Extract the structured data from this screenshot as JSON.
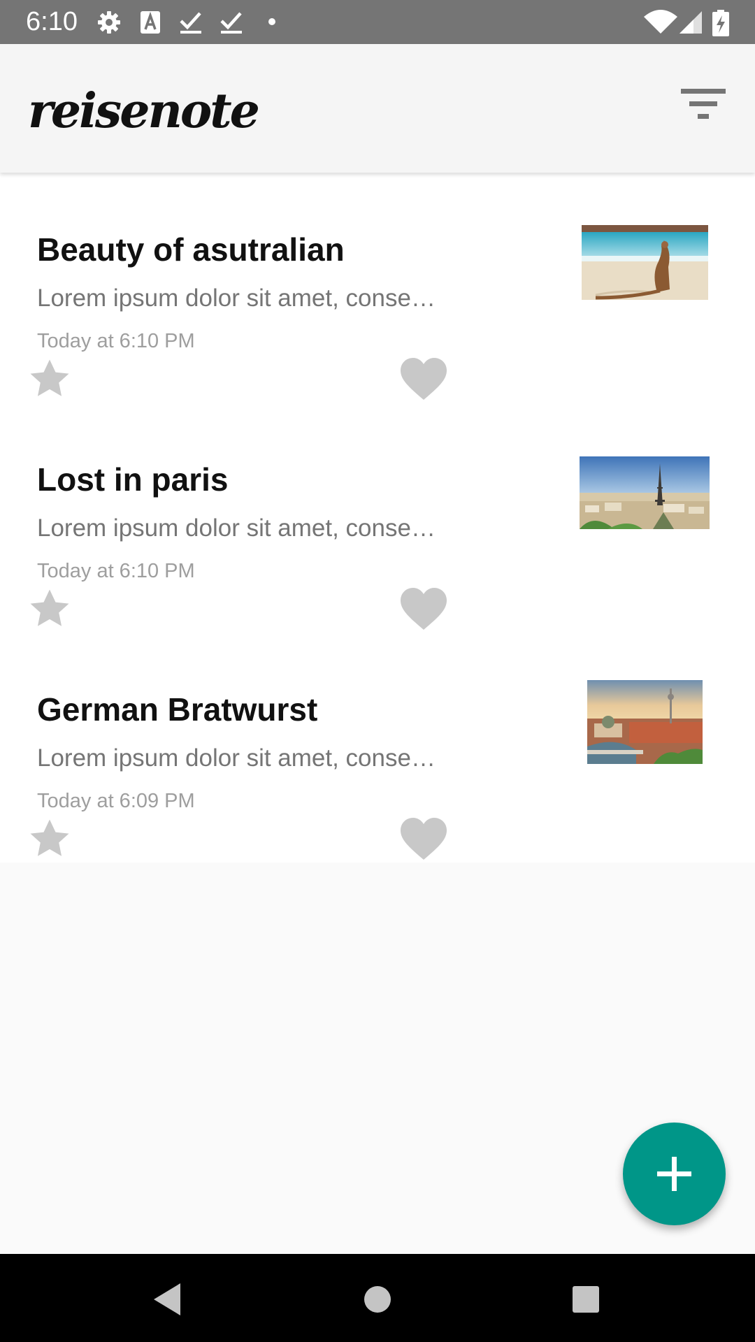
{
  "status_bar": {
    "time": "6:10",
    "icons": [
      "gear-icon",
      "a-keyboard-icon",
      "check-icon",
      "check-icon",
      "dot-icon",
      "wifi-icon",
      "signal-icon",
      "battery-charging-icon"
    ]
  },
  "app_bar": {
    "logo": "reisenote",
    "filter_icon": "filter-icon"
  },
  "notes": [
    {
      "title": "Beauty of asutralian",
      "body": "Lorem ipsum dolor sit amet, conse…",
      "date": "Today at 6:10 PM",
      "thumbnail": "kangaroo-beach-photo"
    },
    {
      "title": "Lost in paris",
      "body": "Lorem ipsum dolor sit amet, conse…",
      "date": "Today at 6:10 PM",
      "thumbnail": "paris-eiffel-photo"
    },
    {
      "title": "German Bratwurst",
      "body": "Lorem ipsum dolor sit amet, conse…",
      "date": "Today at 6:09 PM",
      "thumbnail": "berlin-city-photo"
    }
  ],
  "fab": {
    "icon": "plus-icon"
  },
  "nav_bar": {
    "icons": [
      "back-icon",
      "home-icon",
      "recents-icon"
    ]
  },
  "colors": {
    "status_bar": "#757575",
    "app_bar": "#f5f5f5",
    "accent": "#009688",
    "icon_gray": "#c8c8c8",
    "nav_bar": "#000000"
  }
}
